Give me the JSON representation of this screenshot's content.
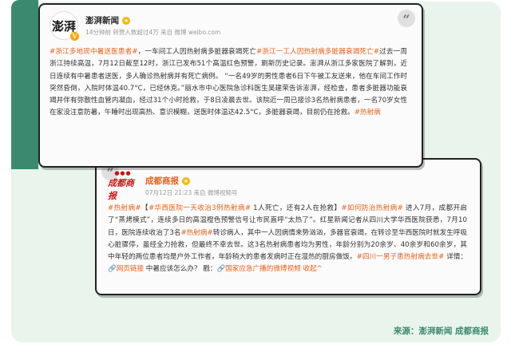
{
  "post1": {
    "account": "澎湃新闻",
    "avatar_text": "澎湃",
    "meta": "14分钟前 转赞人数超过4万  来自 微博 weibo.com",
    "segments": [
      {
        "t": "#浙江多地现中暑送医患者#",
        "link": true
      },
      {
        "t": "，一车间工人因热射病多脏器衰竭死亡",
        "link": false
      },
      {
        "t": "#浙江一工人因热射病多脏器衰竭死亡#",
        "link": true
      },
      {
        "t": "过去一周浙江持续高温，7月12日截至12时，浙江已发布51个高温红色预警，刷新历史记录。澎湃从浙江多家医院了解到，近日连续有中暑患者送医，多人确诊热射病并有死亡病例。 “一名49岁的男性患者6日下午被工友送来，他在车间工作时突然昏倒，入院时体温40.7°C，已经休克。”丽水市中心医院急诊科医生吴建荣告诉澎湃，经检查，患者多脏器功能衰竭并伴有弥散性血管内凝血，经过31个小时抢救，于8日凌晨去世。该院近一周已接诊3名热射病患者，一名70岁女性在家没注意防暑，午睡时出现高热、意识模糊，送医时体温达42.5°C，多脏器衰竭，目前仍在抢救。",
        "link": false
      },
      {
        "t": "#热射病",
        "link": true
      }
    ]
  },
  "post2": {
    "account": "成都商报",
    "avatar_text": "成都商报",
    "meta": "07月12日 21:23  来自 微博视频号",
    "segments": [
      {
        "t": "#热射病#",
        "link": true
      },
      {
        "t": "【",
        "link": false
      },
      {
        "t": "#华西医院一天收治3例热射病#",
        "link": true
      },
      {
        "t": " 1人死亡，还有2人在抢救】",
        "link": false
      },
      {
        "t": "#如何防治热射病#",
        "link": true
      },
      {
        "t": " 进入7月，成都开启了“蒸烤模式”，连续多日的高温橙色预警信号让市民直呼“太热了”。红星新闻记者从四川大学华西医院获悉，7月10日，医院连续收治了3名",
        "link": false
      },
      {
        "t": "#热射病#",
        "link": true
      },
      {
        "t": "转诊病人，其中一人因病情来势汹汹，多器官衰竭，在转诊至华西医院时就发生呼吸心脏骤停，虽经全力抢救，但最终不幸去世。这3名热射病患者均为男性，年龄分别为20余岁、40余岁和60余岁，其中年轻的两位患者均是户外工作者，年龄稍大的患者发病时正在湿热的厨房做饭。",
        "link": false
      },
      {
        "t": "#四川一男子患热射病去世#",
        "link": true
      },
      {
        "t": " 详情：",
        "link": false
      },
      {
        "t": "🔗网页链接",
        "link": true
      },
      {
        "t": " 中暑应该怎么办？ 戳：",
        "link": false
      },
      {
        "t": "🔗国家应急广播的微博视频 收起^",
        "link": true
      }
    ]
  },
  "source": "来源：澎湃新闻 成都商报"
}
